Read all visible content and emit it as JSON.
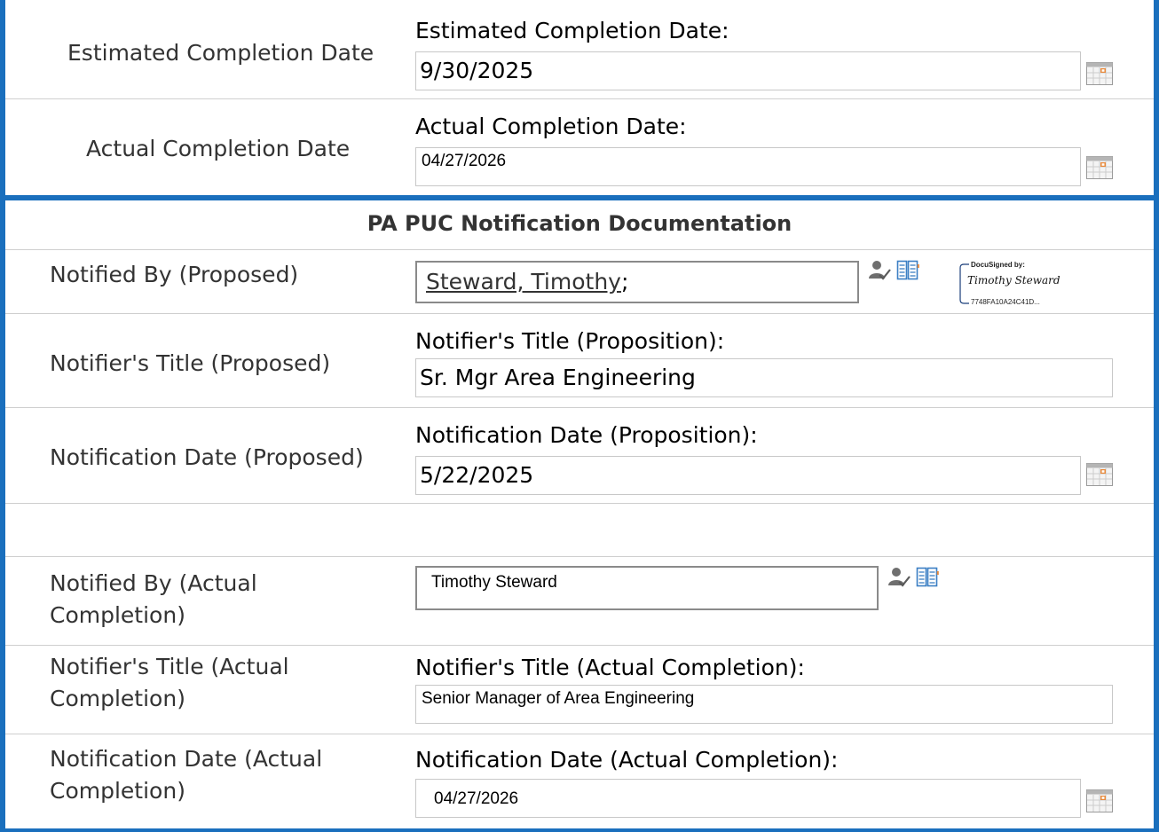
{
  "rows": {
    "estimated": {
      "label": "Estimated Completion Date",
      "field_label": "Estimated Completion Date:",
      "value": "9/30/2025",
      "icon": "calendar-icon"
    },
    "actual": {
      "label": "Actual Completion Date",
      "field_label": "Actual Completion Date:",
      "value": "04/27/2026",
      "icon": "calendar-icon"
    }
  },
  "section": {
    "header": "PA PUC Notification Documentation",
    "notified_by_proposed": {
      "label": "Notified By (Proposed)",
      "value_name": "Steward, Timothy",
      "value_suffix": ";",
      "icons": [
        "user-check-icon",
        "address-book-icon"
      ],
      "signature": {
        "header": "DocuSigned by:",
        "name": "Timothy Steward",
        "id": "7748FA10A24C41D..."
      }
    },
    "title_proposed": {
      "label": "Notifier's Title (Proposed)",
      "field_label": "Notifier's Title (Proposition):",
      "value": "Sr. Mgr Area Engineering"
    },
    "date_proposed": {
      "label": "Notification Date (Proposed)",
      "field_label": "Notification Date (Proposition):",
      "value": "5/22/2025",
      "icon": "calendar-icon"
    },
    "notified_by_actual": {
      "label_line1": "Notified By (Actual",
      "label_line2": "Completion)",
      "value": "Timothy Steward",
      "icons": [
        "user-check-icon",
        "address-book-icon"
      ]
    },
    "title_actual": {
      "label_line1": "Notifier's Title (Actual",
      "label_line2": "Completion)",
      "field_label": "Notifier's Title (Actual Completion):",
      "value": "Senior Manager of Area Engineering"
    },
    "date_actual": {
      "label_line1": "Notification Date (Actual",
      "label_line2": "Completion)",
      "field_label": "Notification Date (Actual Completion):",
      "value": "04/27/2026",
      "icon": "calendar-icon"
    }
  },
  "colors": {
    "panel_border": "#1a6fbd",
    "row_divider": "#cfcfcf",
    "calendar_accent": "#e8893a"
  }
}
